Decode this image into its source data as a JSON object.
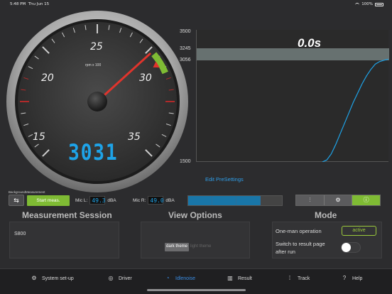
{
  "status": {
    "time": "5:48 PM",
    "date": "Thu Jun 15",
    "battery": "100%"
  },
  "gauge": {
    "numbers": [
      "15",
      "20",
      "25",
      "30",
      "35"
    ],
    "unit": "rpm x 100",
    "digital": "3031",
    "needle_rpm": 3031
  },
  "chart": {
    "time": "0.0s",
    "y_labels": [
      "3500",
      "3245",
      "3056",
      "1500"
    ],
    "edit_presettings": "Edit PreSettings"
  },
  "chart_data": {
    "type": "line",
    "ylim": [
      1500,
      3500
    ],
    "band": [
      3056,
      3245
    ],
    "series": [
      {
        "values": [
          1500,
          1530,
          1620,
          1760,
          1920,
          2080,
          2240,
          2400,
          2540,
          2680,
          2800,
          2900,
          2980,
          3020,
          3040,
          3056
        ]
      }
    ]
  },
  "controls": {
    "background_label": "BackgroundMeasurement",
    "swap_icon": "⇆",
    "start_label": "Start meas.",
    "mic_l_label": "Mic L:",
    "mic_l_value": "49.3",
    "mic_l_unit": "dBA",
    "mic_r_label": "Mic R:",
    "mic_r_value": "49.0",
    "mic_r_unit": "dBA",
    "level_fraction": 0.77
  },
  "sections": {
    "measurement_title": "Measurement Session",
    "session_value": "S800",
    "view_title": "View Options",
    "dark_theme": "dark theme",
    "light_theme": "light theme",
    "mode_title": "Mode",
    "one_man": "One-man operation",
    "active_label": "active",
    "switch_result_1": "Switch to result page",
    "switch_result_2": "after run"
  },
  "tabs": [
    {
      "label": "System set-up",
      "icon": "gear-icon"
    },
    {
      "label": "Driver",
      "icon": "steering-wheel-icon"
    },
    {
      "label": "Idlenoise",
      "icon": "timer-icon"
    },
    {
      "label": "Result",
      "icon": "bar-chart-icon"
    },
    {
      "label": "Track",
      "icon": "traffic-light-icon"
    },
    {
      "label": "Help",
      "icon": "help-icon"
    }
  ],
  "colors": {
    "accent_green": "#7fbb34",
    "accent_blue": "#1ea3e8",
    "needle_red": "#e0342c"
  }
}
